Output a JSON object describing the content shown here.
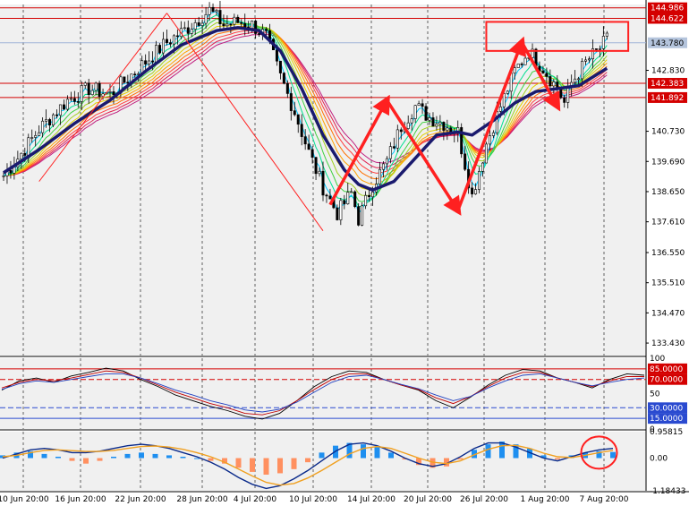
{
  "colors": {
    "background": "#f0f0f0",
    "grid": "#000000",
    "hline": "#d40000",
    "accent_red": "#ff2020",
    "ma_slow": "#1a1a6e",
    "candle": "#000000",
    "rsi_main": "#000000",
    "rsi_signal": "#c00000",
    "rsi_slow": "#2040c0",
    "macd_pos": "#1e8ff0",
    "macd_neg": "#ff9060",
    "macd_fast": "#0a2a8a",
    "macd_slow": "#f0a020"
  },
  "chart_data": [
    {
      "type": "candlestick",
      "panel": "price",
      "title": "",
      "y_ticks": [
        "144.986",
        "144.622",
        "143.780",
        "142.830",
        "142.383",
        "141.892",
        "140.730",
        "139.690",
        "138.650",
        "137.610",
        "136.550",
        "135.510",
        "134.470",
        "133.430"
      ],
      "ylim": [
        133.0,
        145.1
      ],
      "horizontal_levels": [
        144.986,
        144.622,
        143.78,
        142.383,
        141.892
      ],
      "current_price": 143.78,
      "x_tick_labels": [
        "10 Jun 20:00",
        "16 Jun 20:00",
        "22 Jun 20:00",
        "28 Jun 20:00",
        "4 Jul 20:00",
        "10 Jul 20:00",
        "14 Jul 20:00",
        "20 Jul 20:00",
        "26 Jul 20:00",
        "1 Aug 20:00",
        "7 Aug 20:00"
      ],
      "close_path": [
        [
          0,
          139.2
        ],
        [
          4,
          139.8
        ],
        [
          10,
          140.8
        ],
        [
          18,
          141.8
        ],
        [
          24,
          142.2
        ],
        [
          30,
          142.0
        ],
        [
          38,
          142.9
        ],
        [
          46,
          143.8
        ],
        [
          52,
          144.3
        ],
        [
          58,
          144.9
        ],
        [
          62,
          144.4
        ],
        [
          66,
          144.5
        ],
        [
          70,
          144.4
        ],
        [
          74,
          144.0
        ],
        [
          78,
          142.6
        ],
        [
          82,
          141.4
        ],
        [
          86,
          140.0
        ],
        [
          90,
          138.8
        ],
        [
          94,
          137.9
        ],
        [
          98,
          138.6
        ],
        [
          100,
          137.7
        ],
        [
          104,
          138.9
        ],
        [
          108,
          139.7
        ],
        [
          112,
          140.9
        ],
        [
          116,
          141.6
        ],
        [
          120,
          141.2
        ],
        [
          124,
          141.0
        ],
        [
          128,
          140.7
        ],
        [
          130,
          139.6
        ],
        [
          132,
          138.5
        ],
        [
          136,
          140.3
        ],
        [
          140,
          141.6
        ],
        [
          144,
          142.8
        ],
        [
          148,
          143.5
        ],
        [
          152,
          142.9
        ],
        [
          156,
          142.2
        ],
        [
          158,
          141.7
        ],
        [
          160,
          142.4
        ],
        [
          164,
          143.1
        ],
        [
          168,
          143.6
        ],
        [
          170,
          143.9
        ]
      ],
      "rainbow_ma_count": 10,
      "slow_ma": [
        [
          0,
          139.3
        ],
        [
          10,
          140.1
        ],
        [
          20,
          141.0
        ],
        [
          30,
          141.8
        ],
        [
          40,
          142.8
        ],
        [
          50,
          143.7
        ],
        [
          60,
          144.2
        ],
        [
          66,
          144.3
        ],
        [
          72,
          144.2
        ],
        [
          78,
          143.5
        ],
        [
          84,
          142.2
        ],
        [
          90,
          140.6
        ],
        [
          96,
          139.4
        ],
        [
          100,
          138.9
        ],
        [
          104,
          138.7
        ],
        [
          110,
          139.0
        ],
        [
          116,
          139.8
        ],
        [
          122,
          140.6
        ],
        [
          128,
          140.7
        ],
        [
          132,
          140.6
        ],
        [
          138,
          141.1
        ],
        [
          144,
          141.7
        ],
        [
          150,
          142.1
        ],
        [
          156,
          142.2
        ],
        [
          162,
          142.3
        ],
        [
          170,
          142.9
        ]
      ],
      "annotations": [
        {
          "type": "arrow",
          "from": [
            10,
            139.0
          ],
          "to": [
            46,
            144.8
          ]
        },
        {
          "type": "arrow",
          "from": [
            46,
            144.8
          ],
          "to": [
            90,
            137.3
          ]
        },
        {
          "type": "arrow",
          "from": [
            92,
            138.2
          ],
          "to": [
            108,
            141.8
          ]
        },
        {
          "type": "arrow",
          "from": [
            108,
            141.8
          ],
          "to": [
            128,
            138.0
          ]
        },
        {
          "type": "arrow",
          "from": [
            128,
            138.0
          ],
          "to": [
            146,
            143.8
          ]
        },
        {
          "type": "arrow",
          "from": [
            146,
            143.8
          ],
          "to": [
            156,
            141.6
          ]
        },
        {
          "type": "rectangle",
          "from": [
            136,
            144.5
          ],
          "to": [
            176,
            143.5
          ]
        }
      ]
    },
    {
      "type": "line",
      "panel": "rsi",
      "y_ticks": [
        "100",
        "85.0000",
        "70.0000",
        "50",
        "30.0000",
        "15.0000",
        "0"
      ],
      "ylim": [
        0,
        100
      ],
      "levels": [
        85,
        70,
        30,
        15
      ],
      "series": [
        {
          "values": [
            55,
            68,
            72,
            66,
            75,
            80,
            86,
            82,
            70,
            60,
            48,
            40,
            32,
            26,
            18,
            14,
            22,
            40,
            60,
            74,
            82,
            80,
            70,
            62,
            55,
            40,
            30,
            45,
            62,
            76,
            84,
            82,
            72,
            66,
            58,
            70,
            78,
            76
          ]
        },
        {
          "values": [
            58,
            66,
            70,
            68,
            72,
            77,
            82,
            80,
            72,
            62,
            52,
            44,
            36,
            30,
            22,
            20,
            26,
            40,
            56,
            70,
            78,
            78,
            70,
            62,
            56,
            44,
            36,
            46,
            60,
            72,
            80,
            80,
            72,
            66,
            60,
            68,
            74,
            74
          ]
        },
        {
          "values": [
            56,
            64,
            68,
            66,
            70,
            74,
            78,
            78,
            72,
            64,
            55,
            48,
            40,
            34,
            27,
            24,
            28,
            38,
            52,
            66,
            74,
            76,
            70,
            63,
            57,
            48,
            40,
            46,
            58,
            68,
            76,
            78,
            72,
            66,
            61,
            66,
            70,
            72
          ]
        }
      ]
    },
    {
      "type": "bar",
      "panel": "macd",
      "y_ticks": [
        "0.95815",
        "0.00",
        "-1.18433"
      ],
      "ylim": [
        -1.18433,
        0.95815
      ],
      "histogram": [
        0.1,
        0.2,
        0.25,
        0.15,
        0.05,
        -0.1,
        -0.2,
        -0.1,
        0.05,
        0.15,
        0.2,
        0.15,
        0.1,
        0.05,
        0.0,
        -0.1,
        -0.2,
        -0.35,
        -0.5,
        -0.6,
        -0.55,
        -0.4,
        -0.15,
        0.2,
        0.45,
        0.55,
        0.5,
        0.4,
        0.2,
        -0.05,
        -0.25,
        -0.35,
        -0.3,
        -0.05,
        0.3,
        0.5,
        0.6,
        0.5,
        0.35,
        0.1,
        -0.05,
        0.1,
        0.2,
        0.25,
        0.22
      ],
      "macd_line": [
        0.0,
        0.15,
        0.3,
        0.35,
        0.3,
        0.2,
        0.2,
        0.25,
        0.35,
        0.45,
        0.5,
        0.45,
        0.35,
        0.2,
        0.05,
        -0.15,
        -0.4,
        -0.7,
        -0.95,
        -1.1,
        -1.0,
        -0.75,
        -0.45,
        -0.1,
        0.25,
        0.5,
        0.55,
        0.45,
        0.25,
        0.0,
        -0.2,
        -0.3,
        -0.2,
        0.05,
        0.35,
        0.55,
        0.55,
        0.4,
        0.2,
        0.0,
        -0.1,
        0.05,
        0.2,
        0.3,
        0.35
      ],
      "signal_line": [
        0.05,
        0.1,
        0.2,
        0.28,
        0.3,
        0.27,
        0.24,
        0.24,
        0.28,
        0.35,
        0.42,
        0.44,
        0.4,
        0.32,
        0.2,
        0.05,
        -0.15,
        -0.4,
        -0.65,
        -0.88,
        -0.98,
        -0.92,
        -0.72,
        -0.45,
        -0.15,
        0.15,
        0.35,
        0.42,
        0.35,
        0.18,
        0.0,
        -0.15,
        -0.2,
        -0.1,
        0.12,
        0.32,
        0.45,
        0.46,
        0.35,
        0.18,
        0.05,
        0.02,
        0.1,
        0.2,
        0.28
      ],
      "annotations": [
        {
          "type": "circle",
          "around": "last bars"
        }
      ]
    }
  ]
}
